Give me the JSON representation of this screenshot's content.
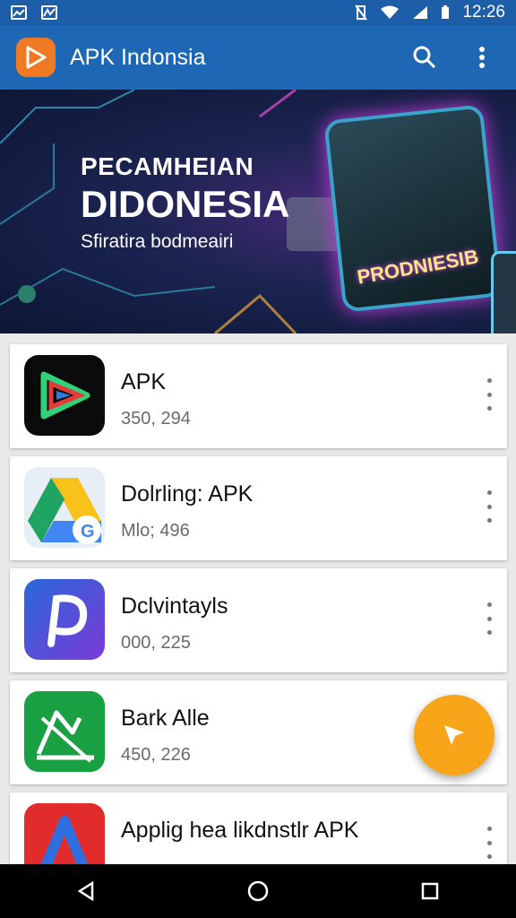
{
  "status": {
    "time": "12:26"
  },
  "app": {
    "title": "APK Indonsia"
  },
  "banner": {
    "line1": "PECAMHEIAN",
    "line2": "DIDONESIA",
    "line3": "Sfiratira bodmeairi",
    "tablet_text": "PRODNIESIB"
  },
  "apps": [
    {
      "name": "APK",
      "meta": "350, 294",
      "icon": "play-logo-icon"
    },
    {
      "name": "Dolrling: APK",
      "meta": "Mlo; 496",
      "icon": "drive-icon"
    },
    {
      "name": "Dclvintayls",
      "meta": "000, 225",
      "icon": "p-logo-icon"
    },
    {
      "name": "Bark Alle",
      "meta": "450, 226",
      "icon": "hand-chart-icon"
    },
    {
      "name": "Applig hea likdnstlr APK",
      "meta": "",
      "icon": "a-logo-icon"
    }
  ],
  "colors": {
    "appbar": "#1e67b5",
    "statusbar": "#1c5fa8",
    "fab": "#f9a51a",
    "logo": "#f07a23"
  }
}
